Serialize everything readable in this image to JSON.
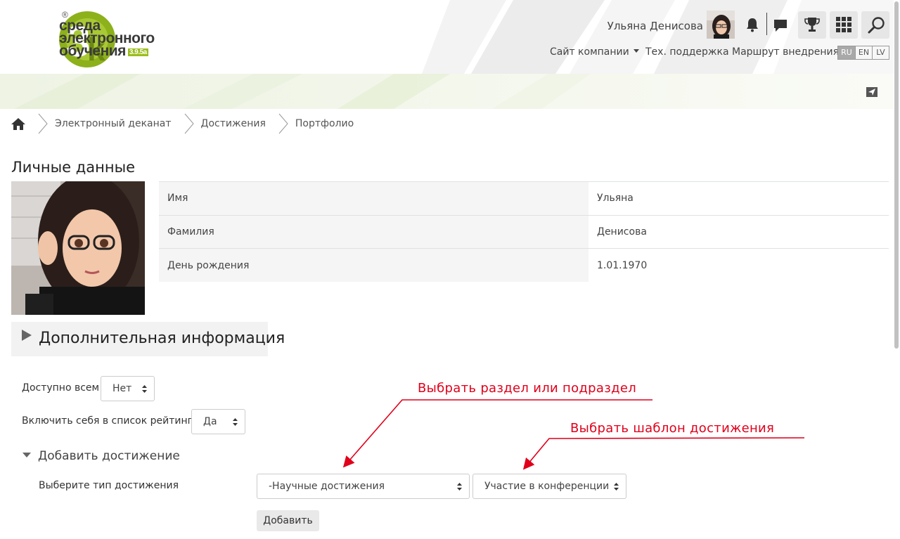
{
  "logo": {
    "line1": "среда",
    "line2": "электронного",
    "line3": "обучения",
    "version": "3.9.5a",
    "reg": "®"
  },
  "header": {
    "user_name": "Ульяна Денисова",
    "nav": {
      "company_site": "Сайт компании",
      "support": "Тех. поддержка",
      "route": "Маршрут внедрения"
    },
    "languages": [
      "RU",
      "EN",
      "LV"
    ],
    "active_language": "RU"
  },
  "breadcrumb": {
    "items": [
      "Электронный деканат",
      "Достижения",
      "Портфолио"
    ]
  },
  "personal": {
    "title": "Личные данные",
    "rows": [
      {
        "label": "Имя",
        "value": "Ульяна"
      },
      {
        "label": "Фамилия",
        "value": "Денисова"
      },
      {
        "label": "День рождения",
        "value": "1.01.1970"
      }
    ]
  },
  "extra_info": {
    "title": "Дополнительная информация"
  },
  "form": {
    "available_label": "Доступно всем",
    "available_value": "Нет",
    "rating_label": "Включить себя в список рейтинга",
    "rating_value": "Да",
    "add_section_title": "Добавить достижение",
    "type_label": "Выберите тип достижения",
    "section_value": "-Научные достижения",
    "template_value": "Участие в конференции",
    "add_button": "Добавить"
  },
  "annotations": {
    "section_hint": "Выбрать раздел или подраздел",
    "template_hint": "Выбрать шаблон достижения",
    "color": "#e0001b"
  },
  "colors": {
    "brand_green": "#9bbd1c",
    "text": "#333333"
  }
}
